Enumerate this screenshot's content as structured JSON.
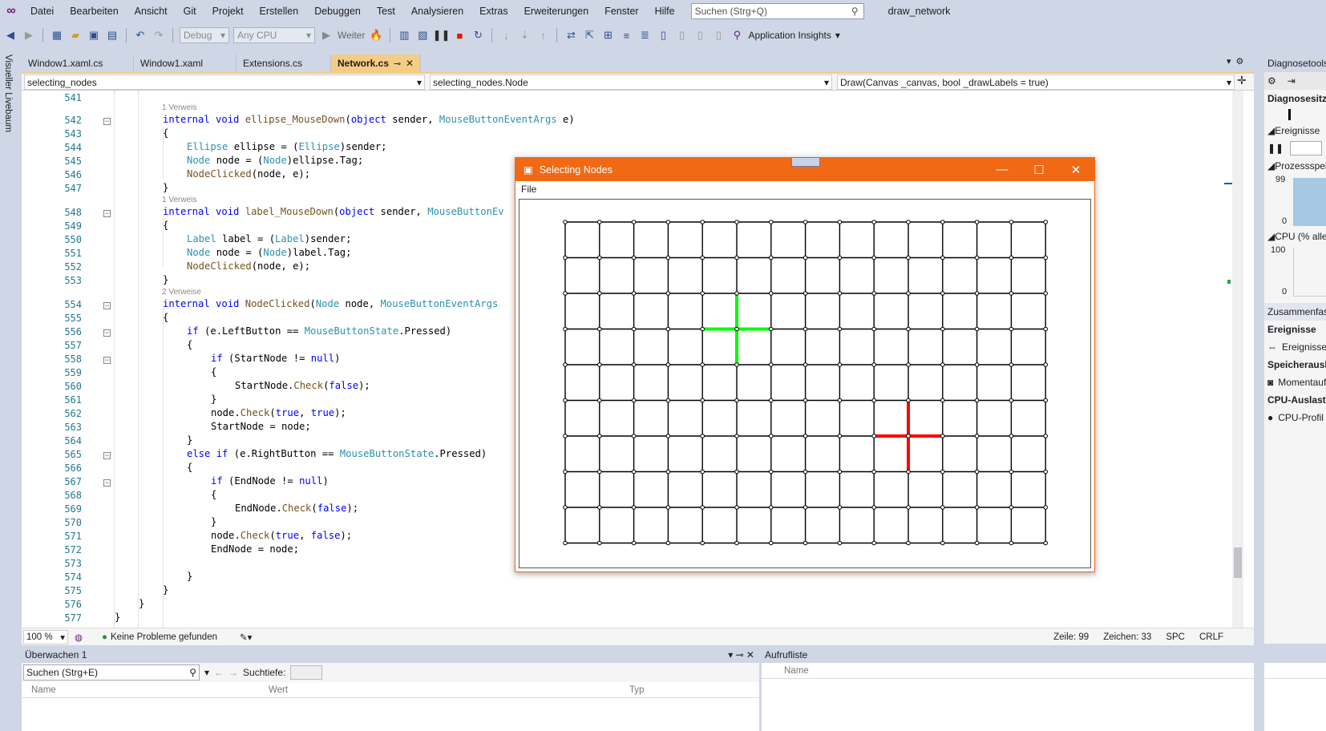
{
  "menu": {
    "items": [
      "Datei",
      "Bearbeiten",
      "Ansicht",
      "Git",
      "Projekt",
      "Erstellen",
      "Debuggen",
      "Test",
      "Analysieren",
      "Extras",
      "Erweiterungen",
      "Fenster",
      "Hilfe"
    ],
    "search_placeholder": "Suchen (Strg+Q)",
    "solution": "draw_network"
  },
  "toolbar": {
    "config": "Debug",
    "platform": "Any CPU",
    "continue": "Weiter",
    "insights": "Application Insights"
  },
  "left_strip": {
    "label": "Visueller Livebaum"
  },
  "tabs": [
    {
      "label": "Window1.xaml.cs"
    },
    {
      "label": "Window1.xaml"
    },
    {
      "label": "Extensions.cs"
    },
    {
      "label": "Network.cs",
      "active": true
    }
  ],
  "nav": {
    "project": "selecting_nodes",
    "type": "selecting_nodes.Node",
    "member": "Draw(Canvas _canvas, bool _drawLabels = true)"
  },
  "status": {
    "zoom": "100 %",
    "problems": "Keine Probleme gefunden",
    "line": "Zeile: 99",
    "col": "Zeichen: 33",
    "spc": "SPC",
    "crlf": "CRLF"
  },
  "watch": {
    "title": "Überwachen 1",
    "search": "Suchen (Strg+E)",
    "depth_label": "Suchtiefe:",
    "cols": [
      "Name",
      "Wert",
      "Typ"
    ]
  },
  "callstack": {
    "title": "Aufrufliste",
    "cols": [
      "Name"
    ]
  },
  "diag": {
    "title": "Diagnosetools",
    "session": "Diagnosesitzung",
    "events": "Ereignisse",
    "process": "Prozessspeicher",
    "cpu": "CPU (% aller",
    "p99": "99",
    "p0": "0",
    "c100": "100",
    "c0": "0",
    "summary": "Zusammenfassung",
    "events2": "Ereignisse",
    "events_item": "Ereignisse",
    "mem": "Speicherauslastung",
    "mem_item": "Momentaufnahme",
    "cpu2": "CPU-Auslastung",
    "cpu_item": "CPU-Profil"
  },
  "app": {
    "title": "Selecting Nodes",
    "menu_file": "File",
    "grid": {
      "cols": 15,
      "rows": 10,
      "start_node": [
        5,
        3
      ],
      "end_node": [
        10,
        6
      ],
      "start_color": "#00ff00",
      "end_color": "#ff0000"
    }
  },
  "code": {
    "lens1": "1 Verweis",
    "lens2": "1 Verweis",
    "lens3": "2 Verweise"
  }
}
